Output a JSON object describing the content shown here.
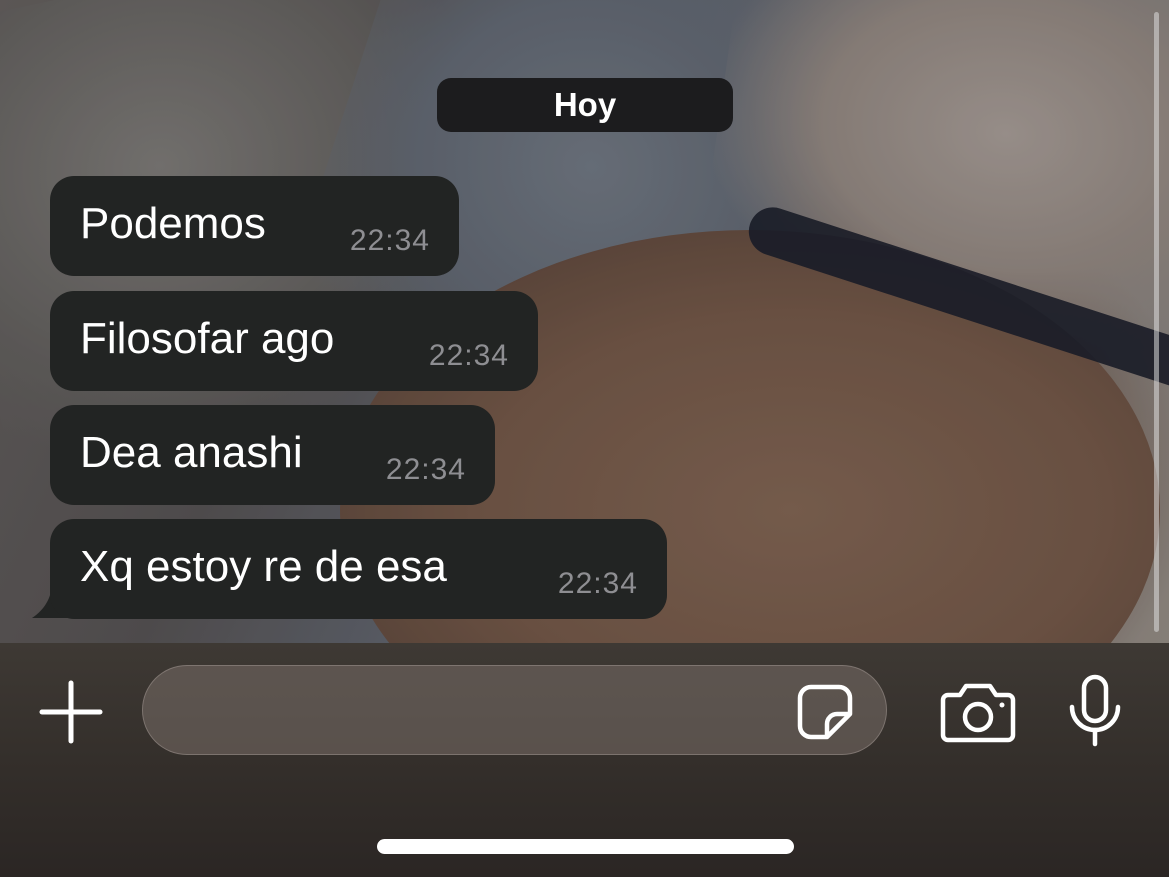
{
  "chat": {
    "date_separator": "Hoy",
    "messages": [
      {
        "text": "Podemos",
        "time": "22:34"
      },
      {
        "text": "Filosofar ago",
        "time": "22:34"
      },
      {
        "text": "Dea anashi",
        "time": "22:34"
      },
      {
        "text": "Xq estoy re de esa",
        "time": "22:34"
      }
    ]
  },
  "composer": {
    "message_value": "",
    "icons": {
      "attach": "plus-icon",
      "sticker": "sticker-icon",
      "camera": "camera-icon",
      "microphone": "microphone-icon"
    }
  },
  "colors": {
    "bubble_incoming": "#222423",
    "timestamp": "#8e8e92",
    "date_pill": "#1c1c1e",
    "icon": "#ffffff"
  }
}
